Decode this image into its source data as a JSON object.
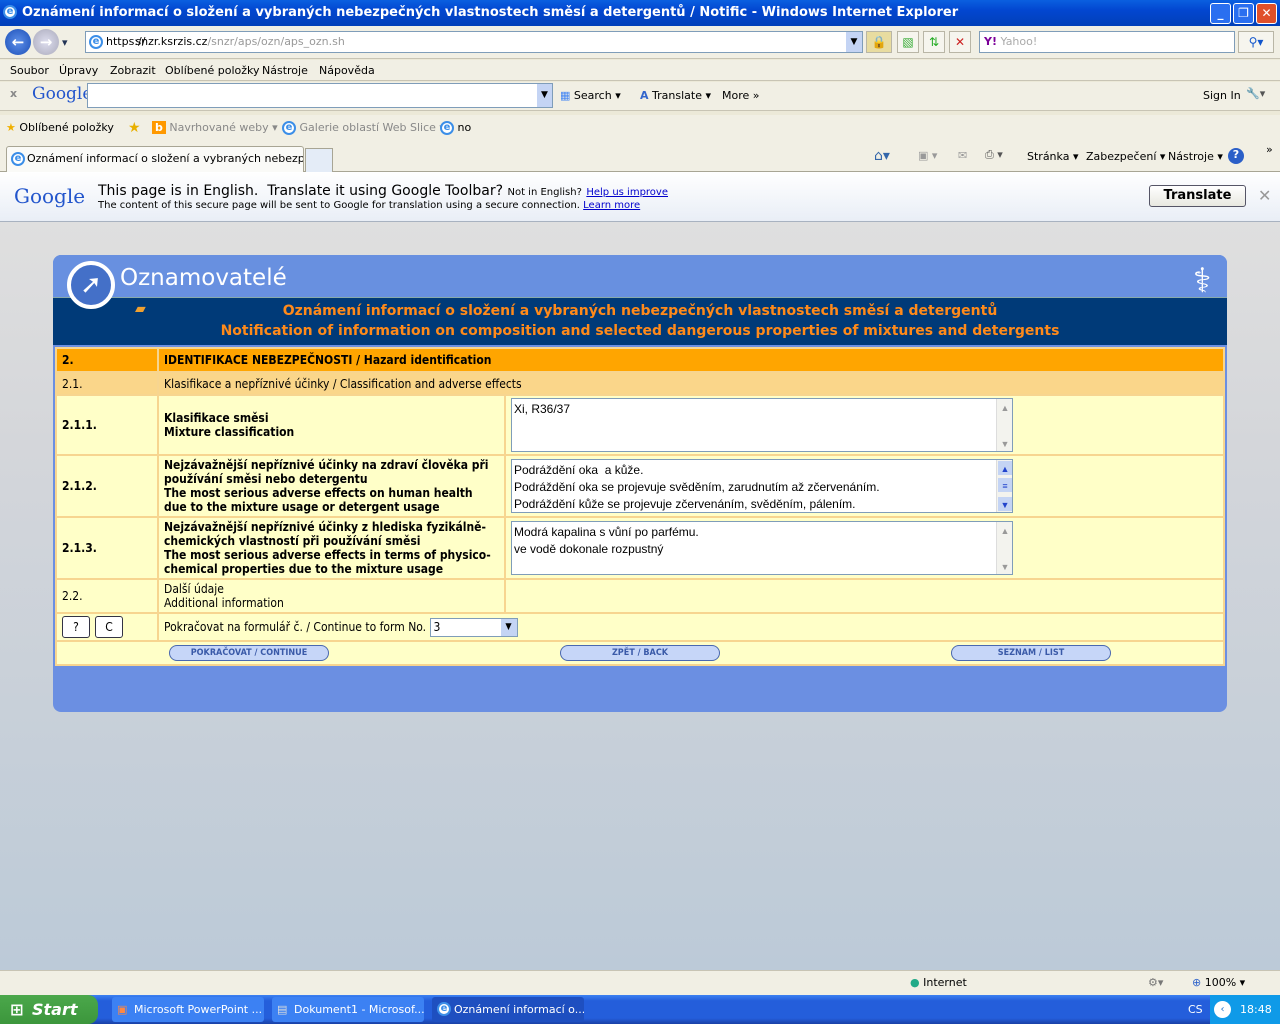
{
  "window": {
    "title": "Oznámení informací o složení a vybraných nebezpečných vlastnostech směsí a detergentů / Notific - Windows Internet Explorer"
  },
  "address": {
    "scheme": "https://",
    "host": "snzr.ksrzis.cz",
    "path": "/snzr/aps/ozn/aps_ozn.sh",
    "search_placeholder": "Yahoo!"
  },
  "menu": [
    "Soubor",
    "Úpravy",
    "Zobrazit",
    "Oblíbené položky",
    "Nástroje",
    "Nápověda"
  ],
  "google_toolbar": {
    "logo": "Google",
    "search": "Search",
    "translate": "Translate",
    "more": "More »",
    "sign_in": "Sign In"
  },
  "favorites": {
    "label": "Oblíbené položky",
    "items": [
      "Navrhované weby",
      "Galerie oblastí Web Slice",
      "no"
    ]
  },
  "tab": {
    "title": "Oznámení informací o složení a vybraných nebezpečn..."
  },
  "command_bar": [
    "Stránka",
    "Zabezpečení",
    "Nástroje"
  ],
  "translate_bar": {
    "logo": "Google",
    "message": "This page is in English.  Translate it using Google Toolbar?",
    "not_english": "Not in English?",
    "help_link": "Help us improve",
    "secure_note": "The content of this secure page will be sent to Google for translation using a secure connection.",
    "learn_more": "Learn more",
    "button": "Translate"
  },
  "page": {
    "app_name": "Oznamovatelé",
    "heading_cz": "Oznámení informací o složení a vybraných nebezpečných vlastnostech směsí a detergentů",
    "heading_en": "Notification of information on composition and selected dangerous properties of mixtures and detergents",
    "section": {
      "num": "2.",
      "title": "IDENTIFIKACE NEBEZPEČNOSTI / Hazard identification"
    },
    "subsection": {
      "num": "2.1.",
      "title": "Klasifikace a nepříznivé účinky / Classification and adverse effects"
    },
    "rows": [
      {
        "num": "2.1.1.",
        "label_cz": "Klasifikace směsi",
        "label_en": "Mixture classification",
        "value": "Xi, R36/37"
      },
      {
        "num": "2.1.2.",
        "label_cz": "Nejzávažnější nepříznivé účinky na zdraví člověka při používání směsi nebo detergentu",
        "label_en": "The most serious adverse effects on human health due to the mixture usage or detergent usage",
        "value": "Podráždění oka  a kůže.\nPodráždění oka se projevuje svěděním, zarudnutím až zčervenáním.\nPodráždění kůže se projevuje zčervenáním, svěděním, pálením."
      },
      {
        "num": "2.1.3.",
        "label_cz": "Nejzávažnější nepříznivé účinky z hlediska fyzikálně-chemických vlastností při používání směsi",
        "label_en": "The most serious adverse effects in terms of physico-chemical properties due to the mixture usage",
        "value": "Modrá kapalina s vůní po parfému.\nve vodě dokonale rozpustný"
      }
    ],
    "additional": {
      "num": "2.2.",
      "label_cz": "Další údaje",
      "label_en": "Additional information"
    },
    "help_btn": "?",
    "clear_btn": "C",
    "continue_label": "Pokračovat na formulář č. / Continue to form No.",
    "continue_value": "3",
    "buttons": {
      "continue": "POKRAČOVAT / CONTINUE",
      "back": "ZPĚT / BACK",
      "list": "SEZNAM / LIST"
    }
  },
  "statusbar": {
    "zone": "Internet",
    "zoom": "100%"
  },
  "taskbar": {
    "start": "Start",
    "tasks": [
      "Microsoft PowerPoint ...",
      "Dokument1 - Microsof...",
      "Oznámení informací o..."
    ],
    "lang": "CS",
    "time": "18:48"
  }
}
